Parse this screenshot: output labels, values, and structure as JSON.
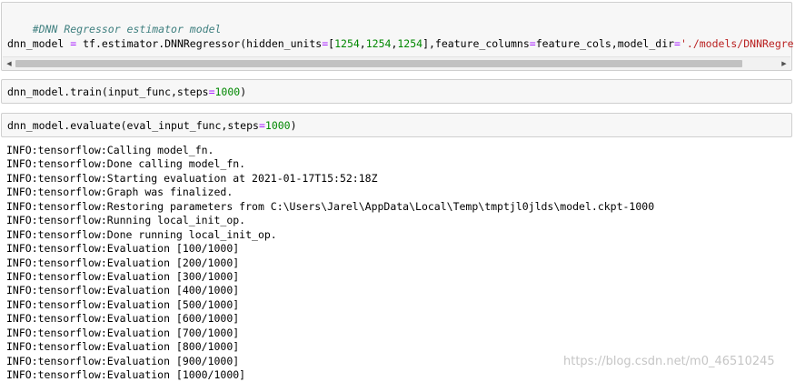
{
  "cells": [
    {
      "comment": "#DNN Regressor estimator model",
      "code": {
        "t1": "dnn_model ",
        "op": "=",
        "t2": " tf.estimator.DNNRegressor(hidden_units",
        "op2": "=",
        "t3": "[",
        "n1": "1254",
        "t4": ",",
        "n2": "1254",
        "t5": ",",
        "n3": "1254",
        "t6": "],feature_columns",
        "op3": "=",
        "t7": "feature_cols,model_dir",
        "op4": "=",
        "str": "'./models/DNNRegre"
      }
    },
    {
      "code": {
        "t1": "dnn_model.train(input_func,steps",
        "op": "=",
        "num": "1000",
        "t2": ")"
      }
    },
    {
      "code": {
        "t1": "dnn_model.evaluate(eval_input_func,steps",
        "op": "=",
        "num": "1000",
        "t2": ")"
      }
    }
  ],
  "output_lines": [
    "INFO:tensorflow:Calling model_fn.",
    "INFO:tensorflow:Done calling model_fn.",
    "INFO:tensorflow:Starting evaluation at 2021-01-17T15:52:18Z",
    "INFO:tensorflow:Graph was finalized.",
    "INFO:tensorflow:Restoring parameters from C:\\Users\\Jarel\\AppData\\Local\\Temp\\tmptjl0jlds\\model.ckpt-1000",
    "INFO:tensorflow:Running local_init_op.",
    "INFO:tensorflow:Done running local_init_op.",
    "INFO:tensorflow:Evaluation [100/1000]",
    "INFO:tensorflow:Evaluation [200/1000]",
    "INFO:tensorflow:Evaluation [300/1000]",
    "INFO:tensorflow:Evaluation [400/1000]",
    "INFO:tensorflow:Evaluation [500/1000]",
    "INFO:tensorflow:Evaluation [600/1000]",
    "INFO:tensorflow:Evaluation [700/1000]",
    "INFO:tensorflow:Evaluation [800/1000]",
    "INFO:tensorflow:Evaluation [900/1000]",
    "INFO:tensorflow:Evaluation [1000/1000]"
  ],
  "watermark": "https://blog.csdn.net/m0_46510245",
  "icons": {
    "scroll_left": "triangle-left",
    "scroll_right": "triangle-right"
  },
  "colors": {
    "comment": "#408080",
    "operator": "#aa22ff",
    "number": "#008800",
    "string": "#ba2121",
    "cell_bg": "#f7f7f7"
  }
}
